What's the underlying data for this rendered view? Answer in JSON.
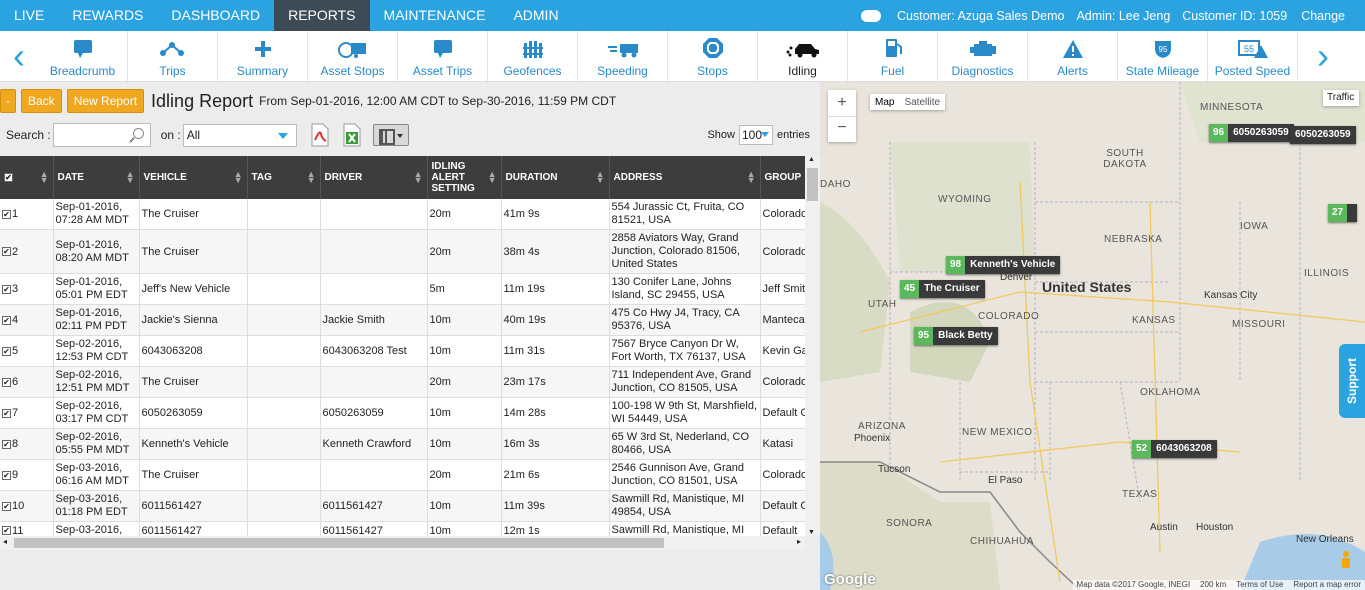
{
  "topnav": {
    "items": [
      "LIVE",
      "REWARDS",
      "DASHBOARD",
      "REPORTS",
      "MAINTENANCE",
      "ADMIN"
    ],
    "customer": "Customer: Azuga Sales Demo",
    "admin": "Admin: Lee Jeng",
    "customer_id": "Customer ID: 1059",
    "change": "Change"
  },
  "iconbar": {
    "items": [
      "Breadcrumb",
      "Trips",
      "Summary",
      "Asset Stops",
      "Asset Trips",
      "Geofences",
      "Speeding",
      "Stops",
      "Idling",
      "Fuel",
      "Diagnostics",
      "Alerts",
      "State Mileage",
      "Posted Speed"
    ]
  },
  "report": {
    "minus_btn": "-",
    "back_btn": "Back",
    "new_btn": "New Report",
    "title": "Idling Report",
    "subtitle": "From Sep-01-2016, 12:00 AM CDT to Sep-30-2016, 11:59 PM CDT",
    "search_label": "Search :",
    "on_label": "on :",
    "on_value": "All",
    "show_label": "Show",
    "show_value": "100",
    "entries_label": "entries"
  },
  "table": {
    "headers": [
      "DATE",
      "VEHICLE",
      "TAG",
      "DRIVER",
      "IDLING ALERT SETTING",
      "DURATION",
      "ADDRESS",
      "GROUP"
    ],
    "rows": [
      {
        "n": "1",
        "date": "Sep-01-2016, 07:28 AM MDT",
        "vehicle": "The Cruiser",
        "tag": "",
        "driver": "",
        "setting": "20m",
        "duration": "41m 9s",
        "address": "554 Jurassic Ct, Fruita, CO 81521, USA",
        "group": "Colorado"
      },
      {
        "n": "2",
        "date": "Sep-01-2016, 08:20 AM MDT",
        "vehicle": "The Cruiser",
        "tag": "",
        "driver": "",
        "setting": "20m",
        "duration": "38m 4s",
        "address": "2858 Aviators Way, Grand Junction, Colorado 81506, United States",
        "group": "Colorado"
      },
      {
        "n": "3",
        "date": "Sep-01-2016, 05:01 PM EDT",
        "vehicle": "Jeff's New Vehicle",
        "tag": "",
        "driver": "",
        "setting": "5m",
        "duration": "11m 19s",
        "address": "130 Conifer Lane, Johns Island, SC 29455, USA",
        "group": "Jeff Smith"
      },
      {
        "n": "4",
        "date": "Sep-01-2016, 02:11 PM PDT",
        "vehicle": "Jackie's Sienna",
        "tag": "",
        "driver": "Jackie Smith",
        "setting": "10m",
        "duration": "40m 19s",
        "address": "475 Co Hwy J4, Tracy, CA 95376, USA",
        "group": "Manteca"
      },
      {
        "n": "5",
        "date": "Sep-02-2016, 12:53 PM CDT",
        "vehicle": "6043063208",
        "tag": "",
        "driver": "6043063208 Test",
        "setting": "10m",
        "duration": "11m 31s",
        "address": "7567 Bryce Canyon Dr W, Fort Worth, TX 76137, USA",
        "group": "Kevin Ga"
      },
      {
        "n": "6",
        "date": "Sep-02-2016, 12:51 PM MDT",
        "vehicle": "The Cruiser",
        "tag": "",
        "driver": "",
        "setting": "20m",
        "duration": "23m 17s",
        "address": "711 Independent Ave, Grand Junction, CO 81505, USA",
        "group": "Colorado"
      },
      {
        "n": "7",
        "date": "Sep-02-2016, 03:17 PM CDT",
        "vehicle": "6050263059",
        "tag": "",
        "driver": "6050263059",
        "setting": "10m",
        "duration": "14m 28s",
        "address": "100-198 W 9th St, Marshfield, WI 54449, USA",
        "group": "Default G"
      },
      {
        "n": "8",
        "date": "Sep-02-2016, 05:55 PM MDT",
        "vehicle": "Kenneth's Vehicle",
        "tag": "",
        "driver": "Kenneth Crawford",
        "setting": "10m",
        "duration": "16m 3s",
        "address": "65 W 3rd St, Nederland, CO 80466, USA",
        "group": "Katasi"
      },
      {
        "n": "9",
        "date": "Sep-03-2016, 06:16 AM MDT",
        "vehicle": "The Cruiser",
        "tag": "",
        "driver": "",
        "setting": "20m",
        "duration": "21m 6s",
        "address": "2546 Gunnison Ave, Grand Junction, CO 81501, USA",
        "group": "Colorado"
      },
      {
        "n": "10",
        "date": "Sep-03-2016, 01:18 PM EDT",
        "vehicle": "6011561427",
        "tag": "",
        "driver": "6011561427",
        "setting": "10m",
        "duration": "11m 39s",
        "address": "Sawmill Rd, Manistique, MI 49854, USA",
        "group": "Default G"
      },
      {
        "n": "11",
        "date": "Sep-03-2016,",
        "vehicle": "6011561427",
        "tag": "",
        "driver": "6011561427",
        "setting": "10m",
        "duration": "12m 1s",
        "address": "Sawmill Rd, Manistique, MI",
        "group": "Default"
      }
    ]
  },
  "map": {
    "type_map": "Map",
    "type_sat": "Satellite",
    "traffic": "Traffic",
    "zoom_in": "+",
    "zoom_out": "−",
    "country": "United States",
    "states": [
      "SOUTH DAKOTA",
      "WYOMING",
      "NEBRASKA",
      "IOWA",
      "ILLINOIS",
      "UTAH",
      "COLORADO",
      "KANSAS",
      "MISSOURI",
      "OKLAHOMA",
      "ARIZONA",
      "NEW MEXICO",
      "TEXAS",
      "SONORA",
      "CHIHUAHUA",
      "MINNESOTA",
      "DAHO"
    ],
    "cities": [
      "Denver",
      "Kansas City",
      "Phoenix",
      "Tucson",
      "El Paso",
      "Austin",
      "Houston",
      "New Orleans"
    ],
    "markers": [
      {
        "num": "96",
        "name": "6050263059"
      },
      {
        "num": "98",
        "name": "Kenneth's Vehicle"
      },
      {
        "num": "45",
        "name": "The Cruiser"
      },
      {
        "num": "95",
        "name": "Black Betty"
      },
      {
        "num": "52",
        "name": "6043063208"
      },
      {
        "num": "27",
        "name": ""
      }
    ],
    "extra_marker_name": "6050263059",
    "google": "Google",
    "footer": [
      "Map data ©2017 Google, INEGI",
      "200 km",
      "Terms of Use",
      "Report a map error"
    ],
    "support": "Support"
  }
}
